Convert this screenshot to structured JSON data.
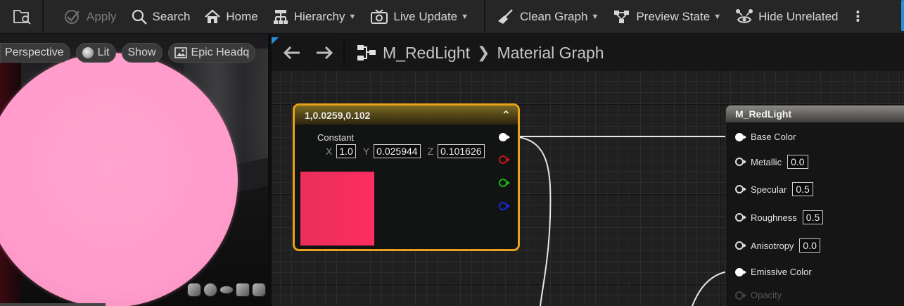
{
  "toolbar": {
    "apply": "Apply",
    "search": "Search",
    "home": "Home",
    "hierarchy": "Hierarchy",
    "live_update": "Live Update",
    "clean_graph": "Clean Graph",
    "preview_state": "Preview State",
    "hide_unrelated": "Hide Unrelated",
    "more": "⋮"
  },
  "viewport": {
    "pills": {
      "perspective": "Perspective",
      "lit": "Lit",
      "show": "Show",
      "preview_scene": "Epic Headq"
    },
    "preview_mesh_icons": [
      "cylinder-icon",
      "sphere-icon",
      "plane-icon",
      "cube-icon",
      "teapot-icon"
    ],
    "sphere_color": "#ff9ccb"
  },
  "graph": {
    "breadcrumb": {
      "material": "M_RedLight",
      "graph": "Material Graph",
      "separator": "❯"
    },
    "constant_node": {
      "title": "1,0.0259,0.102",
      "collapse": "⌃",
      "label": "Constant",
      "x_label": "X",
      "x_value": "1.0",
      "y_label": "Y",
      "y_value": "0.025944",
      "z_label": "Z",
      "z_value": "0.101626",
      "swatch_color": "#ff2e5f",
      "border_color": "#e8a21a"
    },
    "material_node": {
      "title": "M_RedLight",
      "inputs": [
        {
          "label": "Base Color",
          "value": ""
        },
        {
          "label": "Metallic",
          "value": "0.0"
        },
        {
          "label": "Specular",
          "value": "0.5"
        },
        {
          "label": "Roughness",
          "value": "0.5"
        },
        {
          "label": "Anisotropy",
          "value": "0.0"
        },
        {
          "label": "Emissive Color",
          "value": ""
        },
        {
          "label": "Opacity",
          "value": ""
        }
      ]
    }
  }
}
